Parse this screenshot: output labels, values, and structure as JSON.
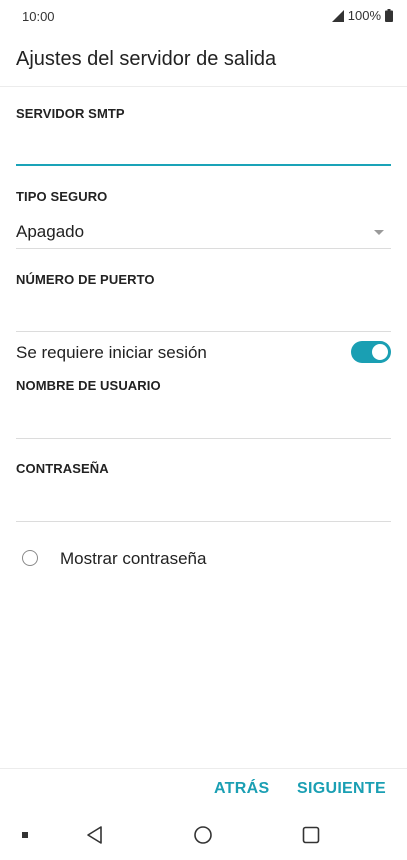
{
  "status_bar": {
    "time": "10:00",
    "battery_percent": "100%"
  },
  "header": {
    "title": "Ajustes del servidor de salida"
  },
  "form": {
    "smtp_server": {
      "label": "SERVIDOR SMTP",
      "value": ""
    },
    "security_type": {
      "label": "TIPO SEGURO",
      "value": "Apagado"
    },
    "port_number": {
      "label": "NÚMERO DE PUERTO",
      "value": ""
    },
    "require_signin": {
      "label": "Se requiere iniciar sesión",
      "on": true
    },
    "username": {
      "label": "NOMBRE DE USUARIO",
      "value": ""
    },
    "password": {
      "label": "CONTRASEÑA",
      "value": ""
    },
    "show_password": {
      "label": "Mostrar contraseña",
      "checked": false
    }
  },
  "actions": {
    "back_label": "ATRÁS",
    "next_label": "SIGUIENTE"
  },
  "colors": {
    "accent": "#1a9fb3"
  },
  "icons": {
    "signal": "signal-icon",
    "battery": "battery-icon",
    "nav_back": "nav-back-icon",
    "nav_home": "nav-home-icon",
    "nav_recent": "nav-recent-apps-icon"
  }
}
